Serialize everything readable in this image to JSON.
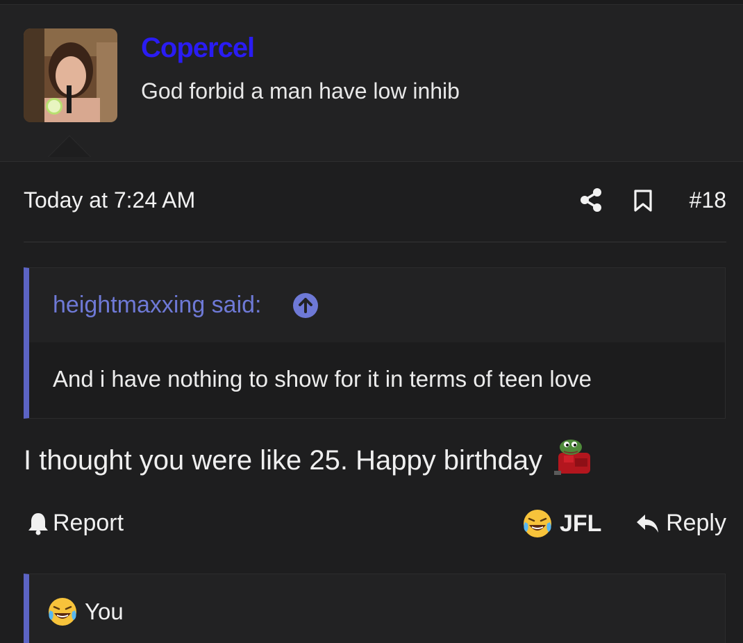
{
  "post": {
    "username": "Copercel",
    "user_title": "God forbid a man have low inhib",
    "date": "Today at 7:24 AM",
    "post_number": "#18",
    "body": "I thought you were like 25. Happy birthday"
  },
  "quote": {
    "author": "heightmaxxing said:",
    "text": "And i have nothing to show for it in terms of teen love"
  },
  "actions": {
    "report_label": "Report",
    "reaction_label": "JFL",
    "reply_label": "Reply"
  },
  "reactions": {
    "label": "You"
  },
  "colors": {
    "username": "#2a1cf3",
    "quote_accent": "#5c64c4",
    "quote_author": "#6e79d6",
    "background": "#1e1e1f"
  },
  "icons": [
    "avatar-photo",
    "share-icon",
    "bookmark-icon",
    "arrow-up-circle-icon",
    "pepe-emoji",
    "bell-icon",
    "laughing-crying-emoji",
    "reply-arrow-icon"
  ]
}
